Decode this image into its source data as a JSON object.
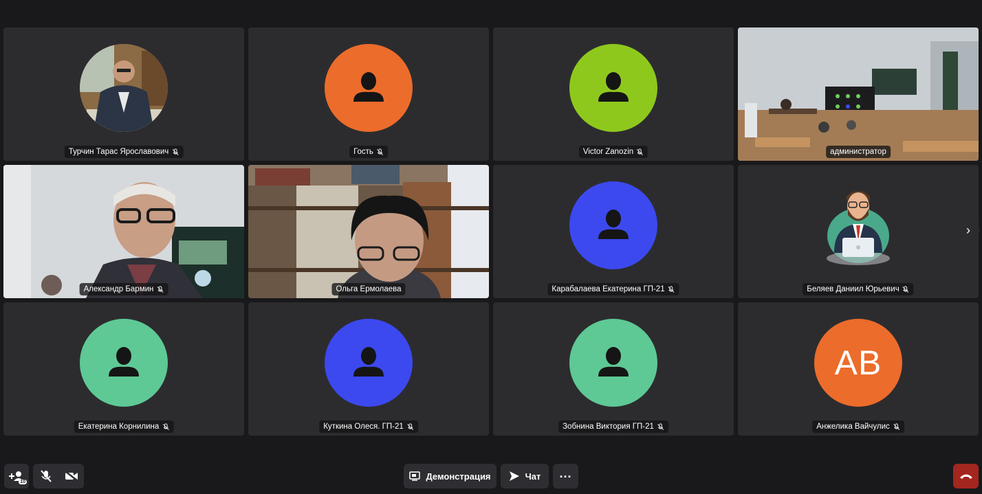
{
  "participants": [
    {
      "name": "Турчин Тарас Ярославович",
      "type": "photo",
      "muted": true
    },
    {
      "name": "Гость",
      "type": "placeholder",
      "color": "#ec6c2b",
      "muted": true
    },
    {
      "name": "Victor Zanozin",
      "type": "placeholder",
      "color": "#8fc81d",
      "muted": true
    },
    {
      "name": "администратор",
      "type": "video",
      "muted": false,
      "active": true
    },
    {
      "name": "Александр Бармин",
      "type": "video",
      "muted": true
    },
    {
      "name": "Ольга Ермолаева",
      "type": "video",
      "muted": false
    },
    {
      "name": "Карабалаева Екатерина ГП-21",
      "type": "placeholder",
      "color": "#3c49ee",
      "muted": true
    },
    {
      "name": "Беляев Даниил Юрьевич",
      "type": "cartoon",
      "muted": true
    },
    {
      "name": "Екатерина Корнилина",
      "type": "placeholder",
      "color": "#5ec995",
      "muted": true
    },
    {
      "name": "Куткина Олеся. ГП-21",
      "type": "placeholder",
      "color": "#3c49ee",
      "muted": true
    },
    {
      "name": "Зобнина Виктория ГП-21",
      "type": "placeholder",
      "color": "#5ec995",
      "muted": true
    },
    {
      "name": "Анжелика Вайчулис",
      "type": "initials",
      "initials": "AB",
      "color": "#ec6c2b",
      "muted": true
    }
  ],
  "toolbar": {
    "invite_badge": "10",
    "screen_share_label": "Демонстрация",
    "chat_label": "Чат",
    "more_label": "..."
  },
  "icons": {
    "next": "chevron-right-icon",
    "invite": "add-person-icon",
    "mic": "mic-off-icon",
    "camera": "camera-off-icon",
    "screen": "screen-share-icon",
    "chat": "send-icon",
    "more": "more-icon",
    "hangup": "hangup-icon"
  }
}
